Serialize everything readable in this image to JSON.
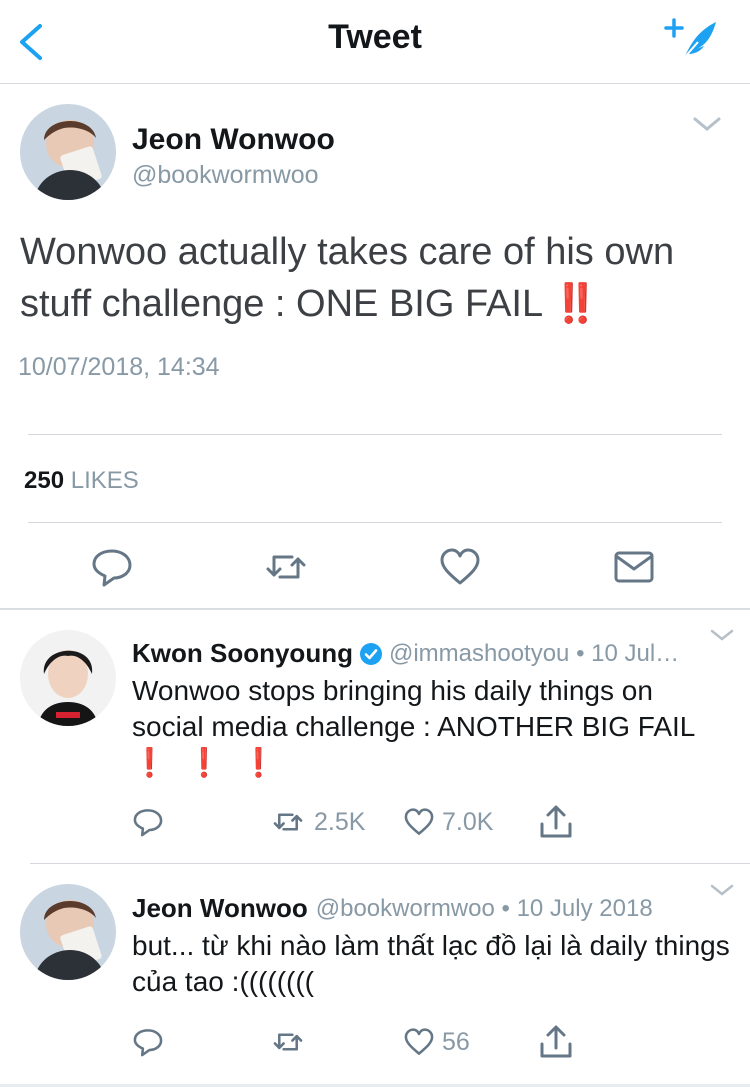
{
  "nav": {
    "title": "Tweet",
    "back_icon": "chevron-left-icon",
    "compose_icon": "compose-tweet-icon"
  },
  "colors": {
    "accent": "#1da1f2",
    "secondary_text": "#8899a6",
    "alert_red": "#e0141e",
    "verified": "#1da1f2"
  },
  "tweet": {
    "author_name": "Jeon Wonwoo",
    "author_handle": "@bookwormwoo",
    "text": "Wonwoo actually takes care of his own stuff challenge : ONE BIG FAIL",
    "emoji": "‼️",
    "timestamp": "10/07/2018, 14:34",
    "likes_count": "250",
    "likes_label": "LIKES",
    "actions": [
      "reply-icon",
      "retweet-icon",
      "like-icon",
      "message-icon"
    ]
  },
  "replies": [
    {
      "author_name": "Kwon Soonyoung",
      "verified": true,
      "meta": "@immashootyou • 10 Jul…",
      "text": "Wonwoo stops bringing his daily things on social media challenge : ANOTHER BIG FAIL",
      "emoji": "❗ ❗ ❗",
      "reply_count": "",
      "retweet_count": "2.5K",
      "like_count": "7.0K"
    },
    {
      "author_name": "Jeon Wonwoo",
      "verified": false,
      "meta": "@bookwormwoo • 10 July 2018",
      "text": "but... từ khi nào làm thất lạc đồ lại là daily things của tao :((((((((",
      "emoji": "",
      "reply_count": "",
      "retweet_count": "",
      "like_count": "56"
    }
  ]
}
